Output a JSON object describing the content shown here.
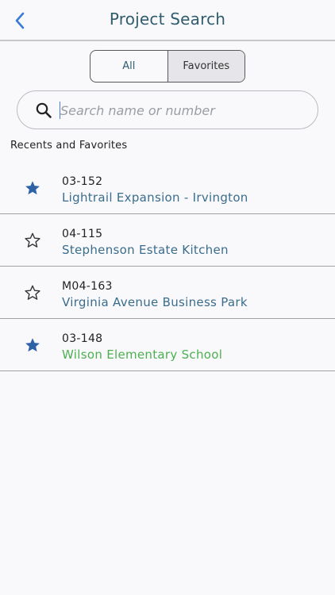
{
  "header": {
    "title": "Project Search"
  },
  "segments": [
    {
      "label": "All",
      "selected": false
    },
    {
      "label": "Favorites",
      "selected": true
    }
  ],
  "search": {
    "placeholder": "Search name or number",
    "value": ""
  },
  "section": {
    "title": "Recents and Favorites"
  },
  "projects": [
    {
      "number": "03-152",
      "name": "Lightrail Expansion - Irvington",
      "favorite": true,
      "name_color": "#3a6d8c"
    },
    {
      "number": "04-115",
      "name": "Stephenson Estate Kitchen",
      "favorite": false,
      "name_color": "#3a6d8c"
    },
    {
      "number": "M04-163",
      "name": "Virginia Avenue Business Park",
      "favorite": false,
      "name_color": "#3a6d8c"
    },
    {
      "number": "03-148",
      "name": "Wilson Elementary School",
      "favorite": true,
      "name_color": "#4caf50"
    }
  ],
  "colors": {
    "accent": "#3a7bd5",
    "star_filled": "#2d63a6",
    "title": "#2f5d6e"
  },
  "icons": {
    "back": "chevron-left-icon",
    "search": "magnifier-icon",
    "favorite": "star-filled-icon",
    "not_favorite": "star-outline-icon"
  }
}
